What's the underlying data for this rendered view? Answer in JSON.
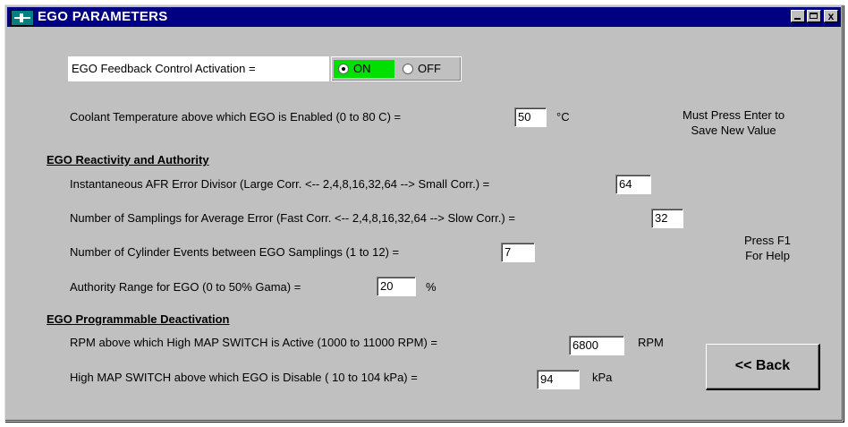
{
  "window": {
    "title": "EGO PARAMETERS",
    "close_glyph": "x"
  },
  "activation": {
    "label": "EGO Feedback Control Activation =",
    "on_label": "ON",
    "off_label": "OFF",
    "selected": "ON"
  },
  "coolant": {
    "label": "Coolant Temperature above which EGO is Enabled (0 to 80 C) =",
    "value": "50",
    "unit": "°C"
  },
  "notes": {
    "enter_line1": "Must Press Enter to",
    "enter_line2": "Save New Value",
    "help_line1": "Press F1",
    "help_line2": "For Help"
  },
  "reactivity": {
    "heading": "EGO Reactivity and Authority",
    "afr_divisor": {
      "label": "Instantaneous AFR Error Divisor (Large Corr. <-- 2,4,8,16,32,64 --> Small Corr.) =",
      "value": "64"
    },
    "samplings": {
      "label": "Number of Samplings for Average Error (Fast Corr. <-- 2,4,8,16,32,64 --> Slow Corr.) =",
      "value": "32"
    },
    "cylinder_events": {
      "label": "Number of Cylinder Events between EGO Samplings (1 to 12) =",
      "value": "7"
    },
    "authority": {
      "label": "Authority Range for EGO (0 to 50% Gama) =",
      "value": "20",
      "unit": "%"
    }
  },
  "deactivation": {
    "heading": "EGO Programmable Deactivation",
    "rpm": {
      "label": "RPM above which High MAP SWITCH is Active (1000 to 11000 RPM) =",
      "value": "6800",
      "unit": "RPM"
    },
    "map": {
      "label": "High MAP SWITCH above which EGO is Disable ( 10 to 104 kPa) =",
      "value": "94",
      "unit": "kPa"
    }
  },
  "back_button": {
    "label": "<< Back"
  }
}
